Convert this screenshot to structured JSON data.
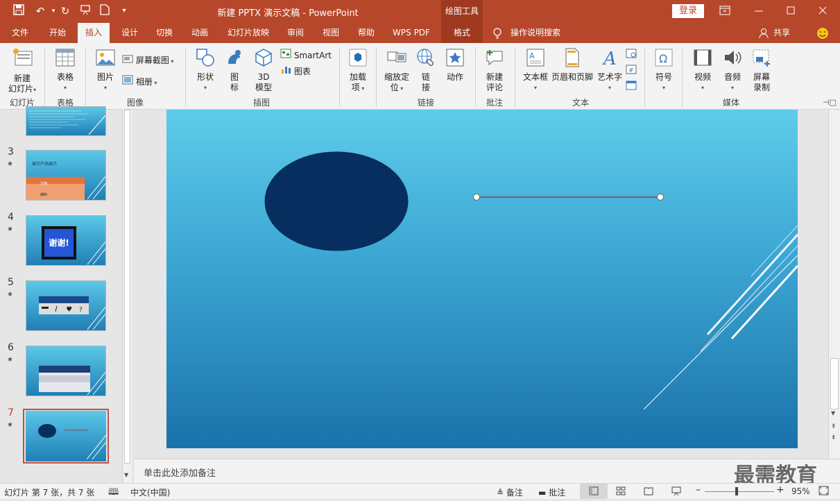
{
  "window": {
    "title": "新建 PPTX 演示文稿  -  PowerPoint",
    "context_tool": "绘图工具",
    "login_label": "登录"
  },
  "tabs": [
    "文件",
    "开始",
    "插入",
    "设计",
    "切换",
    "动画",
    "幻灯片放映",
    "审阅",
    "视图",
    "帮助",
    "WPS PDF",
    "格式"
  ],
  "active_tab": "插入",
  "search_label": "操作说明搜索",
  "share_label": "共享",
  "ribbon": {
    "new_slide": {
      "line1": "新建",
      "line2": "幻灯片"
    },
    "table": "表格",
    "picture": "图片",
    "screenshot": "屏幕截图",
    "album": "相册",
    "shapes": "形状",
    "icons": {
      "line1": "图",
      "line2": "标"
    },
    "model3d": {
      "line1": "3D",
      "line2": "模型"
    },
    "smartart": "SmartArt",
    "chart": "图表",
    "addins": {
      "line1": "加载",
      "line2": "项"
    },
    "zoom": {
      "line1": "缩放定",
      "line2": "位"
    },
    "link": {
      "line1": "链",
      "line2": "接"
    },
    "action": "动作",
    "comment": {
      "line1": "新建",
      "line2": "评论"
    },
    "textbox": "文本框",
    "header_footer": "页眉和页脚",
    "wordart": "艺术字",
    "symbol": "符号",
    "video": "视频",
    "audio": "音频",
    "screen_record": {
      "line1": "屏幕",
      "line2": "录制"
    },
    "groups": {
      "slides": "幻灯片",
      "tables": "表格",
      "images": "图像",
      "illustrations": "插图",
      "links": "链接",
      "comments": "批注",
      "text": "文本",
      "media": "媒体"
    }
  },
  "thumbnails": [
    {
      "num": "3",
      "title": "展示产品展示"
    },
    {
      "num": "4",
      "text": "谢谢!"
    },
    {
      "num": "5"
    },
    {
      "num": "6"
    },
    {
      "num": "7"
    }
  ],
  "thumb3_table": {
    "row1": "文档",
    "row2": "编制"
  },
  "notes_placeholder": "单击此处添加备注",
  "status": {
    "slide_info": "幻灯片 第 7 张，共 7 张",
    "language": "中文(中国)",
    "notes_btn": "备注",
    "comments_btn": "批注",
    "zoom_level": "95%"
  },
  "watermark": "最需教育",
  "colors": {
    "accent": "#b7472a",
    "ellipse": "#062f60"
  }
}
